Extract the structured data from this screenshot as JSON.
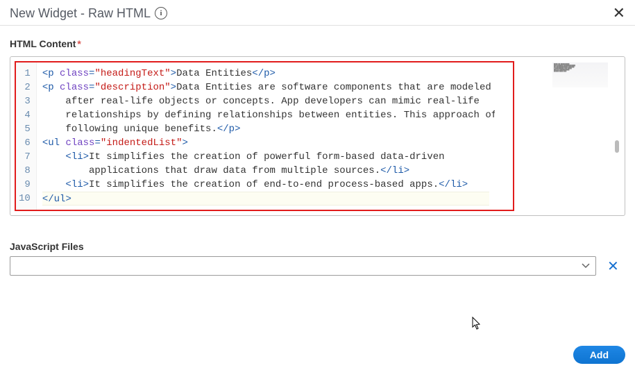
{
  "header": {
    "title": "New Widget - Raw HTML"
  },
  "section": {
    "html_content_label": "HTML Content",
    "required_mark": "*",
    "js_files_label": "JavaScript Files"
  },
  "editor": {
    "line_numbers": [
      "1",
      "2",
      "3",
      "4",
      "5",
      "6",
      "7",
      "8",
      "9",
      "10"
    ],
    "tokens": [
      [
        {
          "t": "pun",
          "v": "<"
        },
        {
          "t": "tag",
          "v": "p "
        },
        {
          "t": "attr",
          "v": "class"
        },
        {
          "t": "pun",
          "v": "="
        },
        {
          "t": "str",
          "v": "\"headingText\""
        },
        {
          "t": "pun",
          "v": ">"
        },
        {
          "t": "txt",
          "v": "Data Entities"
        },
        {
          "t": "pun",
          "v": "</"
        },
        {
          "t": "tag",
          "v": "p"
        },
        {
          "t": "pun",
          "v": ">"
        }
      ],
      [
        {
          "t": "pun",
          "v": "<"
        },
        {
          "t": "tag",
          "v": "p "
        },
        {
          "t": "attr",
          "v": "class"
        },
        {
          "t": "pun",
          "v": "="
        },
        {
          "t": "str",
          "v": "\"description\""
        },
        {
          "t": "pun",
          "v": ">"
        },
        {
          "t": "txt",
          "v": "Data Entities are software components that are modeled"
        }
      ],
      [
        {
          "t": "indent",
          "v": "    "
        },
        {
          "t": "txt",
          "v": "after real-life objects or concepts. App developers can mimic real-life"
        }
      ],
      [
        {
          "t": "indent",
          "v": "    "
        },
        {
          "t": "txt",
          "v": "relationships by defining relationships between entities. This approach offers the"
        }
      ],
      [
        {
          "t": "indent",
          "v": "    "
        },
        {
          "t": "txt",
          "v": "following unique benefits."
        },
        {
          "t": "pun",
          "v": "</"
        },
        {
          "t": "tag",
          "v": "p"
        },
        {
          "t": "pun",
          "v": ">"
        }
      ],
      [
        {
          "t": "pun",
          "v": "<"
        },
        {
          "t": "tag",
          "v": "ul "
        },
        {
          "t": "attr",
          "v": "class"
        },
        {
          "t": "pun",
          "v": "="
        },
        {
          "t": "str",
          "v": "\"indentedList\""
        },
        {
          "t": "pun",
          "v": ">"
        }
      ],
      [
        {
          "t": "indent",
          "v": "    "
        },
        {
          "t": "pun",
          "v": "<"
        },
        {
          "t": "tag",
          "v": "li"
        },
        {
          "t": "pun",
          "v": ">"
        },
        {
          "t": "txt",
          "v": "It simplifies the creation of powerful form-based data-driven"
        }
      ],
      [
        {
          "t": "indent",
          "v": "        "
        },
        {
          "t": "txt",
          "v": "applications that draw data from multiple sources."
        },
        {
          "t": "pun",
          "v": "</"
        },
        {
          "t": "tag",
          "v": "li"
        },
        {
          "t": "pun",
          "v": ">"
        }
      ],
      [
        {
          "t": "indent",
          "v": "    "
        },
        {
          "t": "pun",
          "v": "<"
        },
        {
          "t": "tag",
          "v": "li"
        },
        {
          "t": "pun",
          "v": ">"
        },
        {
          "t": "txt",
          "v": "It simplifies the creation of end-to-end process-based apps."
        },
        {
          "t": "pun",
          "v": "</"
        },
        {
          "t": "tag",
          "v": "li"
        },
        {
          "t": "pun",
          "v": ">"
        }
      ],
      [
        {
          "t": "pun",
          "v": "</"
        },
        {
          "t": "tag",
          "v": "ul"
        },
        {
          "t": "pun",
          "v": ">"
        }
      ]
    ],
    "cursor_line_index": 9
  },
  "footer": {
    "add_label": "Add"
  },
  "colors": {
    "highlight_border": "#e11b1b",
    "primary": "#0e74d1"
  }
}
